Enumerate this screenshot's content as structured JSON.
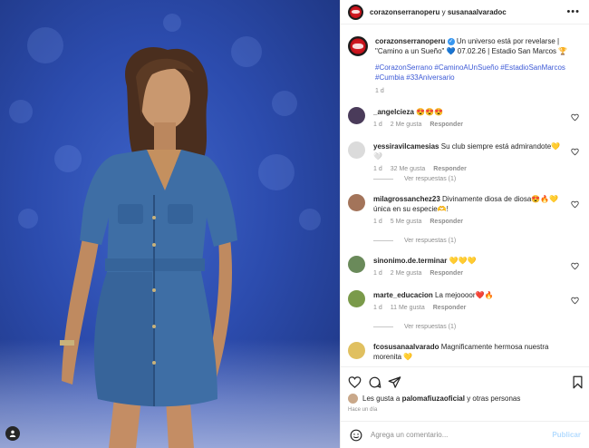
{
  "header": {
    "user1": "corazonserranoperu",
    "conjunction": "y",
    "user2": "susanaalvaradoc",
    "more_icon": "more-horizontal-icon"
  },
  "caption": {
    "username": "corazonserranoperu",
    "text": "Un universo está por revelarse | \"Camino a un Sueño\" 💙 07.02.26 | Estadio San Marcos 🏆",
    "hashtags": "#CorazonSerrano #CaminoAUnSueño #EstadioSanMarcos #Cumbia #33Aniversario",
    "time": "1 d"
  },
  "comments": [
    {
      "username": "_angelcieza",
      "text": "😍😍😍",
      "time": "1 d",
      "likes": "2 Me gusta",
      "reply": "Responder",
      "avatar_color": "#4a3b5a"
    },
    {
      "username": "yessiravilcamesias",
      "text": "Su club siempre está admirandote💛🤍",
      "time": "1 d",
      "likes": "32 Me gusta",
      "reply": "Responder",
      "avatar_color": "#d0d0d0",
      "view_replies": "Ver respuestas (1)"
    },
    {
      "username": "milagrossanchez23",
      "text": "Divinamente diosa de diosa😍🔥💛 única en su especie🫶!",
      "time": "1 d",
      "likes": "5 Me gusta",
      "reply": "Responder",
      "avatar_color": "#a3745a",
      "view_replies": "Ver respuestas (1)"
    },
    {
      "username": "sinonimo.de.terminar",
      "text": "💛💛💛",
      "time": "1 d",
      "likes": "2 Me gusta",
      "reply": "Responder",
      "avatar_color": "#6a8a5a"
    },
    {
      "username": "marte_educacion",
      "text": "La mejoooor❤️🔥",
      "time": "1 d",
      "likes": "11 Me gusta",
      "reply": "Responder",
      "avatar_color": "#7a9a4a",
      "view_replies": "Ver respuestas (1)"
    },
    {
      "username": "fcosusanaalvarado",
      "text": "Magnificamente hermosa nuestra morenita 💛",
      "time": "",
      "likes": "",
      "reply": "",
      "avatar_color": "#e0c060"
    }
  ],
  "actions": {
    "like_icon": "heart-icon",
    "comment_icon": "comment-icon",
    "share_icon": "send-icon",
    "save_icon": "bookmark-icon"
  },
  "likes_text_prefix": "Les gusta a ",
  "likes_user": "palomafiuzaoficial",
  "likes_text_suffix": " y otras personas",
  "post_time": "Hace un día",
  "add_comment": {
    "placeholder": "Agrega un comentario...",
    "post_label": "Publicar"
  },
  "colors": {
    "background_blue": "#2c4cae",
    "link_blue": "#3d5ad6",
    "verified_blue": "#3897f0",
    "post_button": "#b3dbff"
  }
}
